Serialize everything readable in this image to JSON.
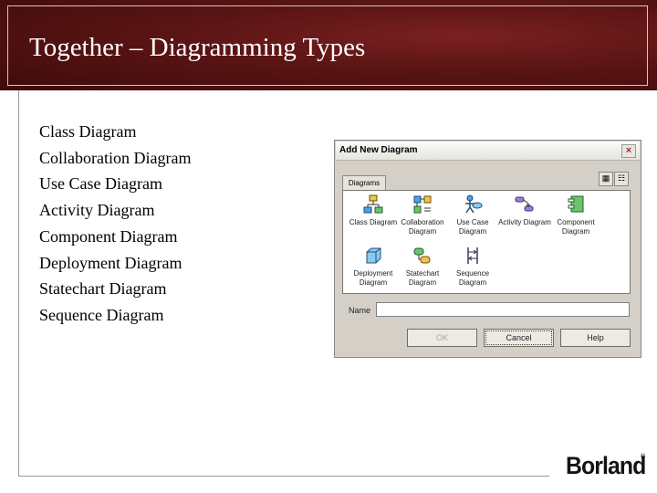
{
  "slide": {
    "title": "Together – Diagramming Types"
  },
  "diagram_types": [
    "Class Diagram",
    "Collaboration Diagram",
    "Use Case Diagram",
    "Activity Diagram",
    "Component Diagram",
    "Deployment Diagram",
    "Statechart Diagram",
    "Sequence Diagram"
  ],
  "dialog": {
    "title": "Add New Diagram",
    "close_glyph": "×",
    "tab_label": "Diagrams",
    "icons_view_glyph": "▦",
    "list_view_glyph": "☷",
    "items": [
      {
        "label": "Class Diagram",
        "icon": "class-diagram-icon"
      },
      {
        "label": "Collaboration Diagram",
        "icon": "collaboration-diagram-icon"
      },
      {
        "label": "Use Case Diagram",
        "icon": "use-case-diagram-icon"
      },
      {
        "label": "Activity Diagram",
        "icon": "activity-diagram-icon"
      },
      {
        "label": "Component Diagram",
        "icon": "component-diagram-icon"
      },
      {
        "label": "Deployment Diagram",
        "icon": "deployment-diagram-icon"
      },
      {
        "label": "Statechart Diagram",
        "icon": "statechart-diagram-icon"
      },
      {
        "label": "Sequence Diagram",
        "icon": "sequence-diagram-icon"
      }
    ],
    "name_label": "Name",
    "name_value": "",
    "buttons": {
      "ok": "OK",
      "cancel": "Cancel",
      "help": "Help"
    }
  },
  "brand": {
    "name": "Borland",
    "registered": "®"
  },
  "colors": {
    "header_bg": "#5a1414",
    "dialog_bg": "#d4d0c8"
  }
}
